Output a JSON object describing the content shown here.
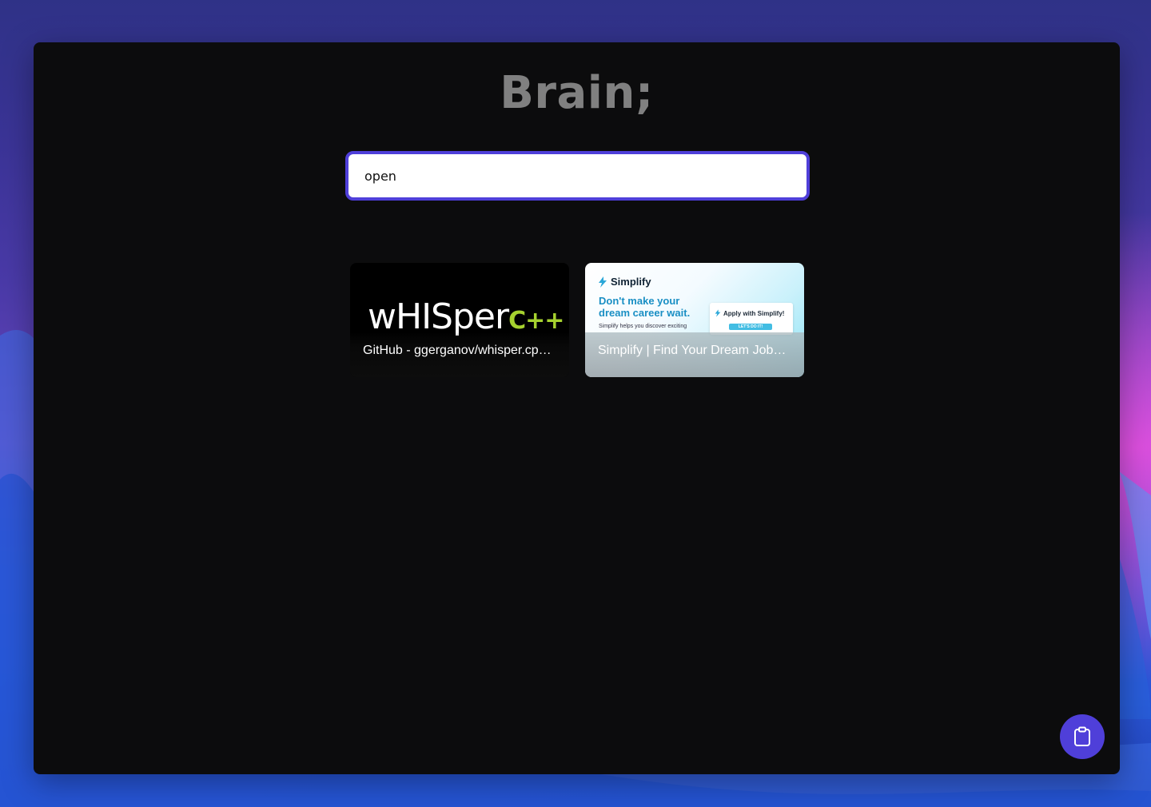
{
  "app": {
    "title": "Brain;"
  },
  "search": {
    "value": "open"
  },
  "results": [
    {
      "title": "GitHub - ggerganov/whisper.cp…",
      "thumbnail": {
        "logo_text": "wHISper",
        "logo_suffix": "C++"
      }
    },
    {
      "title": "Simplify | Find Your Dream Job…",
      "thumbnail": {
        "brand": "Simplify",
        "headline": "Don't make your dream career wait.",
        "subtext": "Simplify helps you discover exciting",
        "panel_label": "Apply with Simplify!",
        "panel_button": "LET'S DO IT!"
      }
    }
  ],
  "fab": {
    "icon": "clipboard-icon"
  },
  "colors": {
    "accent": "#4f3fd9",
    "window_bg": "#0c0c0d",
    "title": "#808080"
  }
}
